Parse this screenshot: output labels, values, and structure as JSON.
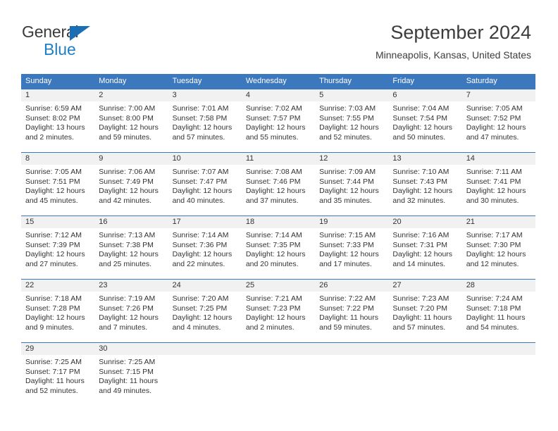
{
  "brand": {
    "name_part1": "General",
    "name_part2": "Blue",
    "accent_color": "#1f7ec4",
    "triangle_color": "#1a6fb4"
  },
  "header": {
    "title": "September 2024",
    "subtitle": "Minneapolis, Kansas, United States",
    "header_bg_color": "#3c78bd",
    "daynum_bg_color": "#f1f1f1"
  },
  "weekdays": [
    "Sunday",
    "Monday",
    "Tuesday",
    "Wednesday",
    "Thursday",
    "Friday",
    "Saturday"
  ],
  "weeks": [
    {
      "days": [
        {
          "num": "1",
          "sunrise": "Sunrise: 6:59 AM",
          "sunset": "Sunset: 8:02 PM",
          "daylight1": "Daylight: 13 hours",
          "daylight2": "and 2 minutes."
        },
        {
          "num": "2",
          "sunrise": "Sunrise: 7:00 AM",
          "sunset": "Sunset: 8:00 PM",
          "daylight1": "Daylight: 12 hours",
          "daylight2": "and 59 minutes."
        },
        {
          "num": "3",
          "sunrise": "Sunrise: 7:01 AM",
          "sunset": "Sunset: 7:58 PM",
          "daylight1": "Daylight: 12 hours",
          "daylight2": "and 57 minutes."
        },
        {
          "num": "4",
          "sunrise": "Sunrise: 7:02 AM",
          "sunset": "Sunset: 7:57 PM",
          "daylight1": "Daylight: 12 hours",
          "daylight2": "and 55 minutes."
        },
        {
          "num": "5",
          "sunrise": "Sunrise: 7:03 AM",
          "sunset": "Sunset: 7:55 PM",
          "daylight1": "Daylight: 12 hours",
          "daylight2": "and 52 minutes."
        },
        {
          "num": "6",
          "sunrise": "Sunrise: 7:04 AM",
          "sunset": "Sunset: 7:54 PM",
          "daylight1": "Daylight: 12 hours",
          "daylight2": "and 50 minutes."
        },
        {
          "num": "7",
          "sunrise": "Sunrise: 7:05 AM",
          "sunset": "Sunset: 7:52 PM",
          "daylight1": "Daylight: 12 hours",
          "daylight2": "and 47 minutes."
        }
      ]
    },
    {
      "days": [
        {
          "num": "8",
          "sunrise": "Sunrise: 7:05 AM",
          "sunset": "Sunset: 7:51 PM",
          "daylight1": "Daylight: 12 hours",
          "daylight2": "and 45 minutes."
        },
        {
          "num": "9",
          "sunrise": "Sunrise: 7:06 AM",
          "sunset": "Sunset: 7:49 PM",
          "daylight1": "Daylight: 12 hours",
          "daylight2": "and 42 minutes."
        },
        {
          "num": "10",
          "sunrise": "Sunrise: 7:07 AM",
          "sunset": "Sunset: 7:47 PM",
          "daylight1": "Daylight: 12 hours",
          "daylight2": "and 40 minutes."
        },
        {
          "num": "11",
          "sunrise": "Sunrise: 7:08 AM",
          "sunset": "Sunset: 7:46 PM",
          "daylight1": "Daylight: 12 hours",
          "daylight2": "and 37 minutes."
        },
        {
          "num": "12",
          "sunrise": "Sunrise: 7:09 AM",
          "sunset": "Sunset: 7:44 PM",
          "daylight1": "Daylight: 12 hours",
          "daylight2": "and 35 minutes."
        },
        {
          "num": "13",
          "sunrise": "Sunrise: 7:10 AM",
          "sunset": "Sunset: 7:43 PM",
          "daylight1": "Daylight: 12 hours",
          "daylight2": "and 32 minutes."
        },
        {
          "num": "14",
          "sunrise": "Sunrise: 7:11 AM",
          "sunset": "Sunset: 7:41 PM",
          "daylight1": "Daylight: 12 hours",
          "daylight2": "and 30 minutes."
        }
      ]
    },
    {
      "days": [
        {
          "num": "15",
          "sunrise": "Sunrise: 7:12 AM",
          "sunset": "Sunset: 7:39 PM",
          "daylight1": "Daylight: 12 hours",
          "daylight2": "and 27 minutes."
        },
        {
          "num": "16",
          "sunrise": "Sunrise: 7:13 AM",
          "sunset": "Sunset: 7:38 PM",
          "daylight1": "Daylight: 12 hours",
          "daylight2": "and 25 minutes."
        },
        {
          "num": "17",
          "sunrise": "Sunrise: 7:14 AM",
          "sunset": "Sunset: 7:36 PM",
          "daylight1": "Daylight: 12 hours",
          "daylight2": "and 22 minutes."
        },
        {
          "num": "18",
          "sunrise": "Sunrise: 7:14 AM",
          "sunset": "Sunset: 7:35 PM",
          "daylight1": "Daylight: 12 hours",
          "daylight2": "and 20 minutes."
        },
        {
          "num": "19",
          "sunrise": "Sunrise: 7:15 AM",
          "sunset": "Sunset: 7:33 PM",
          "daylight1": "Daylight: 12 hours",
          "daylight2": "and 17 minutes."
        },
        {
          "num": "20",
          "sunrise": "Sunrise: 7:16 AM",
          "sunset": "Sunset: 7:31 PM",
          "daylight1": "Daylight: 12 hours",
          "daylight2": "and 14 minutes."
        },
        {
          "num": "21",
          "sunrise": "Sunrise: 7:17 AM",
          "sunset": "Sunset: 7:30 PM",
          "daylight1": "Daylight: 12 hours",
          "daylight2": "and 12 minutes."
        }
      ]
    },
    {
      "days": [
        {
          "num": "22",
          "sunrise": "Sunrise: 7:18 AM",
          "sunset": "Sunset: 7:28 PM",
          "daylight1": "Daylight: 12 hours",
          "daylight2": "and 9 minutes."
        },
        {
          "num": "23",
          "sunrise": "Sunrise: 7:19 AM",
          "sunset": "Sunset: 7:26 PM",
          "daylight1": "Daylight: 12 hours",
          "daylight2": "and 7 minutes."
        },
        {
          "num": "24",
          "sunrise": "Sunrise: 7:20 AM",
          "sunset": "Sunset: 7:25 PM",
          "daylight1": "Daylight: 12 hours",
          "daylight2": "and 4 minutes."
        },
        {
          "num": "25",
          "sunrise": "Sunrise: 7:21 AM",
          "sunset": "Sunset: 7:23 PM",
          "daylight1": "Daylight: 12 hours",
          "daylight2": "and 2 minutes."
        },
        {
          "num": "26",
          "sunrise": "Sunrise: 7:22 AM",
          "sunset": "Sunset: 7:22 PM",
          "daylight1": "Daylight: 11 hours",
          "daylight2": "and 59 minutes."
        },
        {
          "num": "27",
          "sunrise": "Sunrise: 7:23 AM",
          "sunset": "Sunset: 7:20 PM",
          "daylight1": "Daylight: 11 hours",
          "daylight2": "and 57 minutes."
        },
        {
          "num": "28",
          "sunrise": "Sunrise: 7:24 AM",
          "sunset": "Sunset: 7:18 PM",
          "daylight1": "Daylight: 11 hours",
          "daylight2": "and 54 minutes."
        }
      ]
    },
    {
      "days": [
        {
          "num": "29",
          "sunrise": "Sunrise: 7:25 AM",
          "sunset": "Sunset: 7:17 PM",
          "daylight1": "Daylight: 11 hours",
          "daylight2": "and 52 minutes."
        },
        {
          "num": "30",
          "sunrise": "Sunrise: 7:25 AM",
          "sunset": "Sunset: 7:15 PM",
          "daylight1": "Daylight: 11 hours",
          "daylight2": "and 49 minutes."
        },
        {
          "num": "",
          "sunrise": "",
          "sunset": "",
          "daylight1": "",
          "daylight2": ""
        },
        {
          "num": "",
          "sunrise": "",
          "sunset": "",
          "daylight1": "",
          "daylight2": ""
        },
        {
          "num": "",
          "sunrise": "",
          "sunset": "",
          "daylight1": "",
          "daylight2": ""
        },
        {
          "num": "",
          "sunrise": "",
          "sunset": "",
          "daylight1": "",
          "daylight2": ""
        },
        {
          "num": "",
          "sunrise": "",
          "sunset": "",
          "daylight1": "",
          "daylight2": ""
        }
      ]
    }
  ]
}
